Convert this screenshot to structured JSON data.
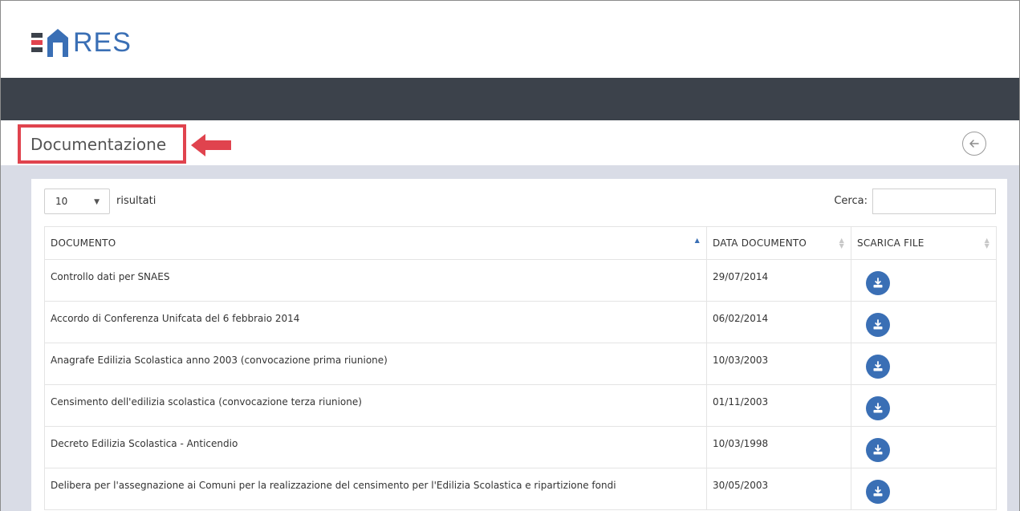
{
  "brand": {
    "logo_text": "RES",
    "accent_color": "#3a6fb5",
    "bar_colors": [
      "#3a6fb5",
      "#e0434e",
      "#3c424b"
    ]
  },
  "page": {
    "title": "Documentazione",
    "back_icon": "back-arrow-circle-icon",
    "highlight_color": "#e0434e"
  },
  "table_controls": {
    "page_size_value": "10",
    "page_size_suffix": "risultati",
    "search_label": "Cerca:",
    "search_value": ""
  },
  "table": {
    "columns": [
      "DOCUMENTO",
      "DATA DOCUMENTO",
      "SCARICA FILE"
    ],
    "sorted_column": "DOCUMENTO",
    "sort_direction": "ascending",
    "download_icon": "download-icon",
    "rows": [
      {
        "document": "Controllo dati per SNAES",
        "date": "29/07/2014"
      },
      {
        "document": "Accordo di Conferenza Unifcata del 6 febbraio 2014",
        "date": "06/02/2014"
      },
      {
        "document": "Anagrafe Edilizia Scolastica anno 2003 (convocazione prima riunione)",
        "date": "10/03/2003"
      },
      {
        "document": "Censimento dell'edilizia scolastica (convocazione terza riunione)",
        "date": "01/11/2003"
      },
      {
        "document": "Decreto Edilizia Scolastica - Anticendio",
        "date": "10/03/1998"
      },
      {
        "document": "Delibera per l'assegnazione ai Comuni per la realizzazione del censimento per l'Edilizia Scolastica e ripartizione fondi",
        "date": "30/05/2003"
      }
    ]
  }
}
